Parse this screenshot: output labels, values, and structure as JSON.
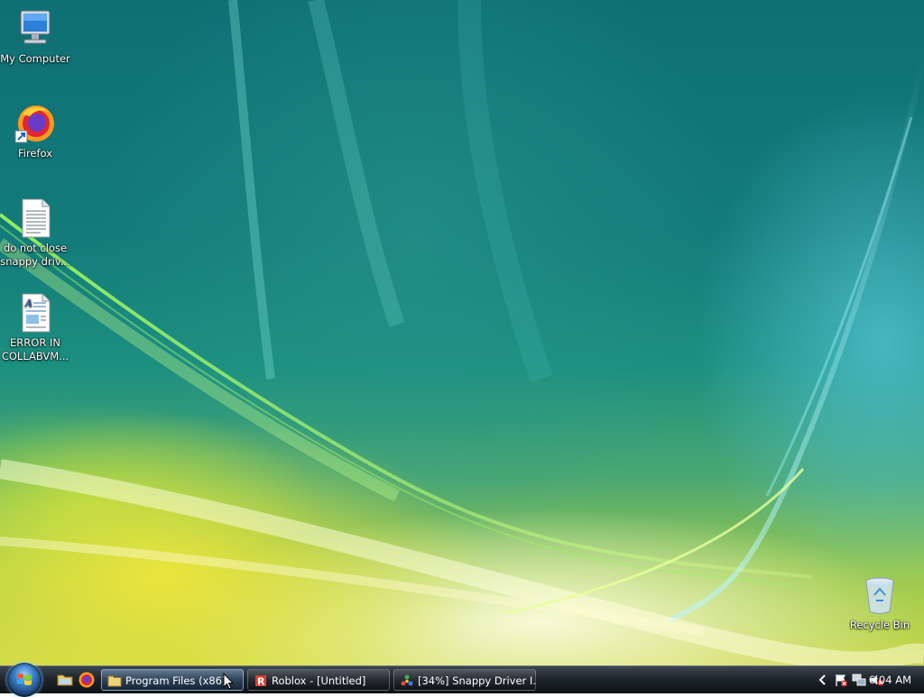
{
  "desktop": {
    "icons": [
      {
        "label": "My Computer",
        "icon": "computer-icon"
      },
      {
        "label": "Firefox",
        "icon": "firefox-icon"
      },
      {
        "label": "do not close snappy driv...",
        "icon": "text-document-icon"
      },
      {
        "label": "ERROR IN COLLABVM...",
        "icon": "wordpad-document-icon"
      },
      {
        "label": "Recycle Bin",
        "icon": "recycle-bin-icon"
      }
    ]
  },
  "taskbar": {
    "start": {
      "icon": "windows-start-orb-icon"
    },
    "quick_launch": [
      {
        "icon": "show-desktop-icon"
      },
      {
        "icon": "firefox-icon"
      }
    ],
    "buttons": [
      {
        "label": "Program Files (x86)",
        "icon": "folder-icon",
        "active": true
      },
      {
        "label": "Roblox - [Untitled]",
        "icon": "roblox-icon",
        "active": false
      },
      {
        "label": "[34%] Snappy Driver I...",
        "icon": "snappy-driver-icon",
        "active": false
      }
    ],
    "tray": {
      "icons": [
        "chevron-left-icon",
        "action-center-flag-icon",
        "network-icon",
        "volume-muted-icon"
      ],
      "clock": "6:04 AM"
    }
  },
  "colors": {
    "taskbar_top": "#3c4650",
    "taskbar_bottom": "#0d1216",
    "desktop_teal": "#137b7a",
    "desktop_yellow": "#c9d84a"
  }
}
